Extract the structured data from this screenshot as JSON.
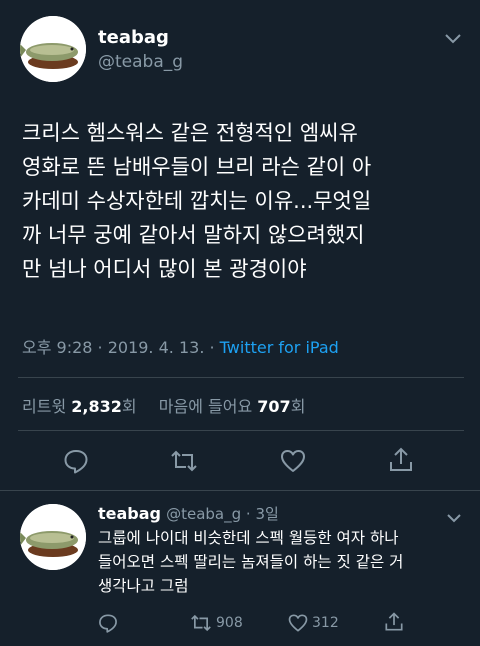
{
  "tweet": {
    "author_name": "teabag",
    "author_handle": "@teaba_g",
    "text_lines": [
      "크리스 헴스워스 같은 전형적인 엠씨유",
      "영화로 뜬 남배우들이 브리 라슨 같이 아",
      "카데미 수상자한테 깝치는 이유...무엇일",
      "까 너무 궁예 같아서 말하지 않으려했지",
      "만 넘나 어디서 많이 본 광경이야"
    ],
    "timestamp": "오후 9:28 · 2019. 4. 13. · ",
    "source": "Twitter for iPad",
    "retweets_label": "리트윗 ",
    "retweets_count": "2,832",
    "retweets_unit": "회",
    "likes_label": "마음에 들어요 ",
    "likes_count": "707",
    "likes_unit": "회"
  },
  "reply": {
    "author_name": "teabag",
    "author_handle": "@teaba_g",
    "age": " · 3일",
    "text_lines": [
      "그룹에 나이대 비슷한데 스펙 월등한 여자 하나",
      "들어오면 스펙 딸리는 놈져들이 하는 짓 같은 거",
      "생각나고 그럼"
    ],
    "retweets": "908",
    "likes": "312"
  },
  "colors": {
    "background": "#15202b",
    "secondary_text": "#8899a6",
    "link": "#1da1f2",
    "divider": "#38444d"
  }
}
